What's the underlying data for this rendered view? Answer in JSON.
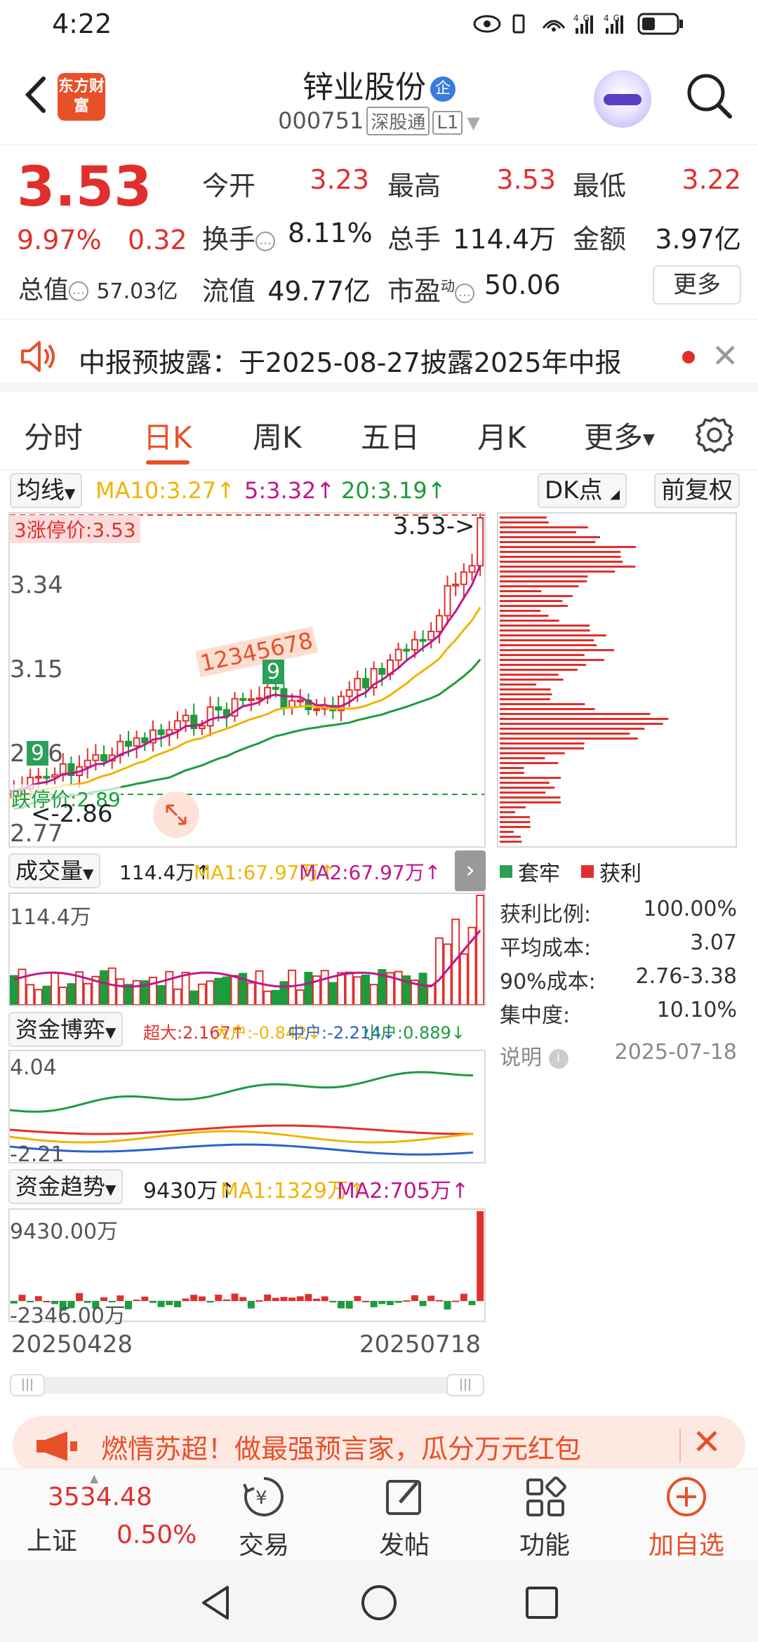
{
  "status_bar": {
    "time": "4:22",
    "network": "4G 4G"
  },
  "header": {
    "logo_text": "东方财富",
    "stock_name": "锌业股份",
    "name_tag": "企",
    "stock_code": "000751",
    "market_tag": "深股通",
    "level_tag": "L1"
  },
  "quote": {
    "price": "3.53",
    "change_pct": "9.97%",
    "change": "0.32",
    "market_cap_label": "总值",
    "market_cap": "57.03亿",
    "open_label": "今开",
    "open": "3.23",
    "high_label": "最高",
    "high": "3.53",
    "low_label": "最低",
    "low": "3.22",
    "turnover_label": "换手",
    "turnover": "8.11%",
    "volume_label": "总手",
    "volume": "114.4万",
    "amount_label": "金额",
    "amount": "3.97亿",
    "float_label": "流值",
    "float_cap": "49.77亿",
    "pe_label": "市盈",
    "pe_sup": "动",
    "pe": "50.06",
    "more_button": "更多"
  },
  "notice": {
    "text": "中报预披露：于2025-08-27披露2025年中报"
  },
  "tabs": [
    {
      "label": "分时"
    },
    {
      "label": "日K"
    },
    {
      "label": "周K"
    },
    {
      "label": "五日"
    },
    {
      "label": "月K"
    },
    {
      "label": "更多"
    }
  ],
  "ma_bar": {
    "selector": "均线",
    "ma10": "MA10:3.27↑",
    "ma5": "5:3.32↑",
    "ma20": "20:3.19↑",
    "dk_button": "DK点",
    "adjust_button": "前复权"
  },
  "kline": {
    "limit_up_label": "涨停价:3.53",
    "limit_down_label": "跌停价:2.89",
    "latest_marker": "3.53->",
    "low_marker": "<-2.86",
    "y_ticks": [
      "3.34",
      "3.15",
      "2.96",
      "2.77"
    ],
    "limit_up_prefix": "3",
    "signal_nine": "9",
    "signal_numbers": "12345678"
  },
  "chip": {
    "legend_a": "套牢",
    "legend_b": "获利",
    "rows": [
      {
        "label": "获利比例:",
        "value": "100.00%"
      },
      {
        "label": "平均成本:",
        "value": "3.07"
      },
      {
        "label": "90%成本:",
        "value": "2.76-3.38"
      },
      {
        "label": "集中度:",
        "value": "10.10%"
      }
    ],
    "note_label": "说明",
    "date": "2025-07-18"
  },
  "volume_bar": {
    "selector": "成交量",
    "vol": "114.4万↑",
    "ma1": "MA1:67.97万↑",
    "ma2": "MA2:67.97万↑",
    "top_label": "114.4万"
  },
  "fund_game": {
    "selector": "资金博弈",
    "super": "超大:2.167↑",
    "big": "大户:-0.842↓",
    "mid": "中户:-2.214↓",
    "small": "小户:0.889↓",
    "top_label": "4.04",
    "bottom_label": "-2.21"
  },
  "fund_trend": {
    "selector": "资金趋势",
    "val": "9430万↑",
    "ma1": "MA1:1329万↑",
    "ma2": "MA2:705万↑",
    "top_label": "9430.00万",
    "bottom_label": "-2346.00万"
  },
  "dates": {
    "start": "20250428",
    "end": "20250718"
  },
  "banner": {
    "text": "燃情苏超！做最强预言家，瓜分万元红包"
  },
  "bottom_nav": {
    "index_value": "3534.48",
    "index_name": "上证",
    "index_pct": "0.50%",
    "trade": "交易",
    "post": "发帖",
    "function": "功能",
    "add_watch": "加自选"
  },
  "colors": {
    "up": "#e0302d",
    "down": "#1c9c3c",
    "accent": "#e8502a",
    "ma5": "#c0168c",
    "ma10": "#f0b400",
    "ma20": "#1c9c3c"
  }
}
